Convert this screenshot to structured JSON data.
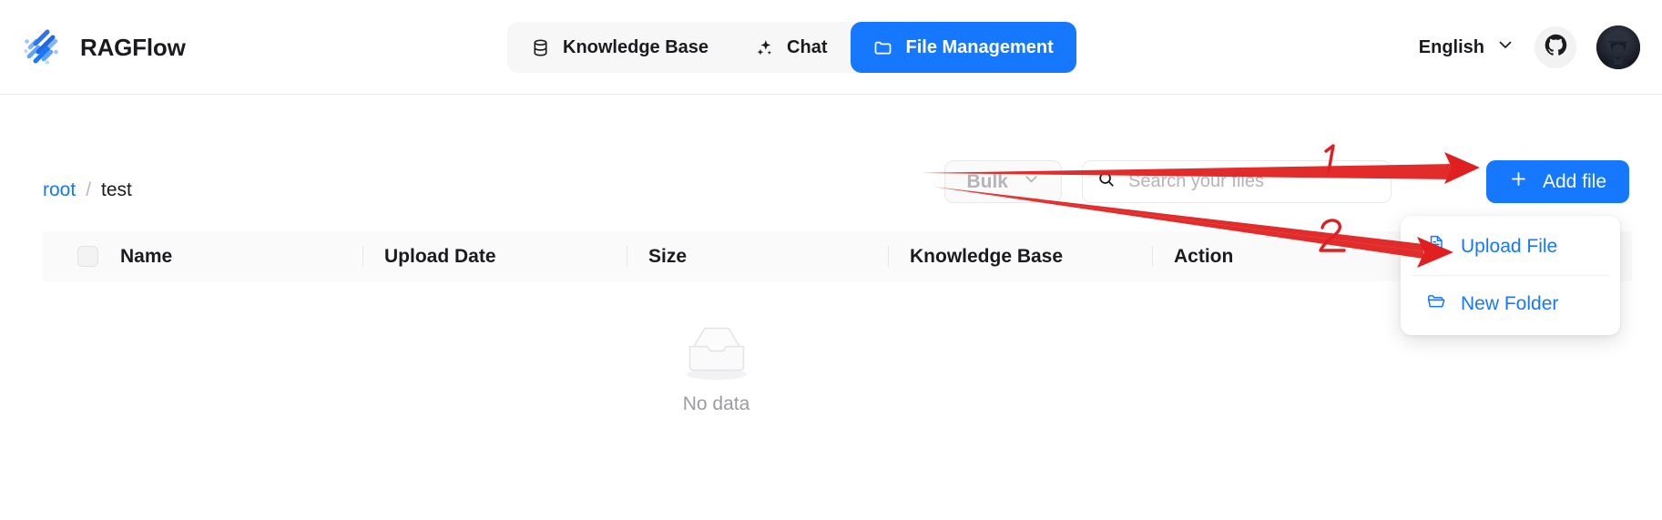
{
  "header": {
    "brand_name": "RAGFlow",
    "logo_icon": "ragflow-stripes-logo",
    "nav": [
      {
        "label": "Knowledge Base",
        "icon": "database-icon",
        "active": false
      },
      {
        "label": "Chat",
        "icon": "sparkle-icon",
        "active": false
      },
      {
        "label": "File Management",
        "icon": "folder-icon",
        "active": true
      }
    ],
    "language": {
      "value": "English",
      "chevron_icon": "chevron-down-icon"
    },
    "github_icon": "github-icon",
    "avatar_icon": "user-avatar"
  },
  "breadcrumb": {
    "root_label": "root",
    "separator": "/",
    "current_label": "test"
  },
  "toolbar": {
    "bulk_label": "Bulk",
    "bulk_chevron_icon": "chevron-down-icon",
    "bulk_disabled": true,
    "search": {
      "icon": "search-icon",
      "value": "",
      "placeholder": "Search your files"
    },
    "add_file_label": "Add file",
    "add_file_icon": "plus-icon"
  },
  "dropdown": {
    "items": [
      {
        "label": "Upload File",
        "icon": "file-document-icon"
      },
      {
        "label": "New Folder",
        "icon": "folder-open-icon"
      }
    ]
  },
  "table": {
    "select_all_checkbox": "unchecked",
    "columns": [
      {
        "label": "Name"
      },
      {
        "label": "Upload Date"
      },
      {
        "label": "Size"
      },
      {
        "label": "Knowledge Base"
      },
      {
        "label": "Action"
      }
    ],
    "rows": [],
    "empty": {
      "icon": "empty-inbox-icon",
      "label": "No data"
    }
  },
  "annotations": [
    {
      "number": "1",
      "target": "add-file-button"
    },
    {
      "number": "2",
      "target": "upload-file-menu-item"
    }
  ],
  "colors": {
    "accent_blue": "#1677ff",
    "annotation_red": "#e02020",
    "text_primary": "#1b1b1f",
    "text_muted": "#9b9ba1",
    "header_row_bg": "#fafafa",
    "nav_group_bg": "#f7f7f8"
  }
}
